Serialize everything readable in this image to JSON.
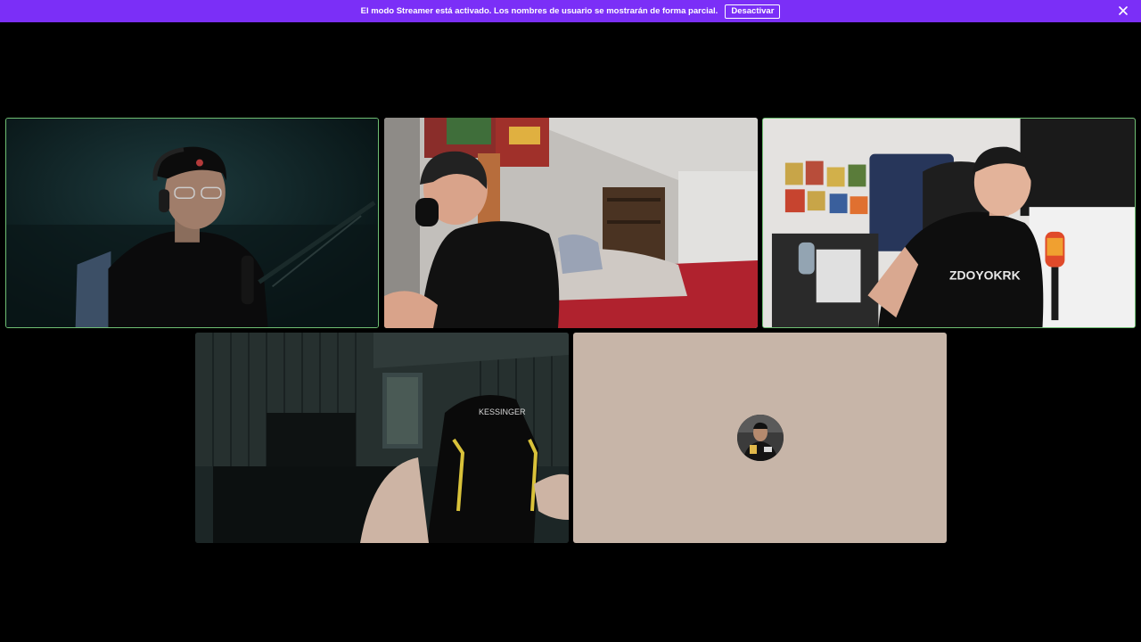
{
  "banner": {
    "message": "El modo Streamer está activado. Los nombres de usuario se mostrarán de forma parcial.",
    "deactivate_label": "Desactivar",
    "close_icon": "close-icon",
    "color": "#7b2ff7"
  },
  "call": {
    "speaking_border_color": "#6fbf73",
    "placeholder_tile_color": "#c7b5a8",
    "participants": [
      {
        "camera": "on",
        "speaking": true
      },
      {
        "camera": "on",
        "speaking": false
      },
      {
        "camera": "on",
        "speaking": true,
        "shirt_text": "ZDOYOKRK"
      },
      {
        "camera": "on",
        "speaking": false,
        "chair_brand": "KESSINGER"
      },
      {
        "camera": "off",
        "speaking": false,
        "avatar_icon": "user-avatar"
      }
    ]
  }
}
